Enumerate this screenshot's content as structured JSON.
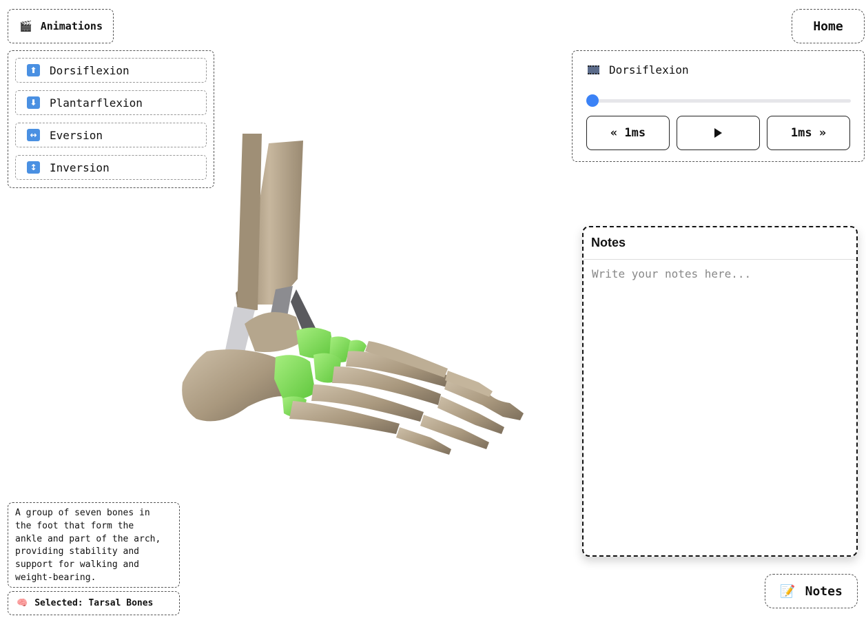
{
  "animations_panel": {
    "header_label": "Animations",
    "header_icon": "clapperboard-icon",
    "items": [
      {
        "label": "Dorsiflexion",
        "icon": "arrow-up-icon",
        "glyph": "⬆"
      },
      {
        "label": "Plantarflexion",
        "icon": "arrow-down-icon",
        "glyph": "⬇"
      },
      {
        "label": "Eversion",
        "icon": "arrow-left-right-icon",
        "glyph": "↔"
      },
      {
        "label": "Inversion",
        "icon": "arrow-up-down-icon",
        "glyph": "↕"
      }
    ]
  },
  "home_button": {
    "label": "Home"
  },
  "player": {
    "title": "Dorsiflexion",
    "title_icon": "film-icon",
    "progress": 0,
    "back_label": "« 1ms",
    "forward_label": "1ms »",
    "play_icon": "play-icon",
    "accent_color": "#3b82f6"
  },
  "notes_panel": {
    "title": "Notes",
    "placeholder": "Write your notes here..."
  },
  "notes_button": {
    "label": "Notes",
    "icon": "memo-icon"
  },
  "description": {
    "text": "A group of seven bones in\nthe foot that form the\nankle and part of the arch,\nproviding stability and\nsupport for walking and\nweight-bearing."
  },
  "selection": {
    "label": "Selected: Tarsal Bones",
    "icon": "brain-icon",
    "highlight_color": "#7ed957"
  }
}
